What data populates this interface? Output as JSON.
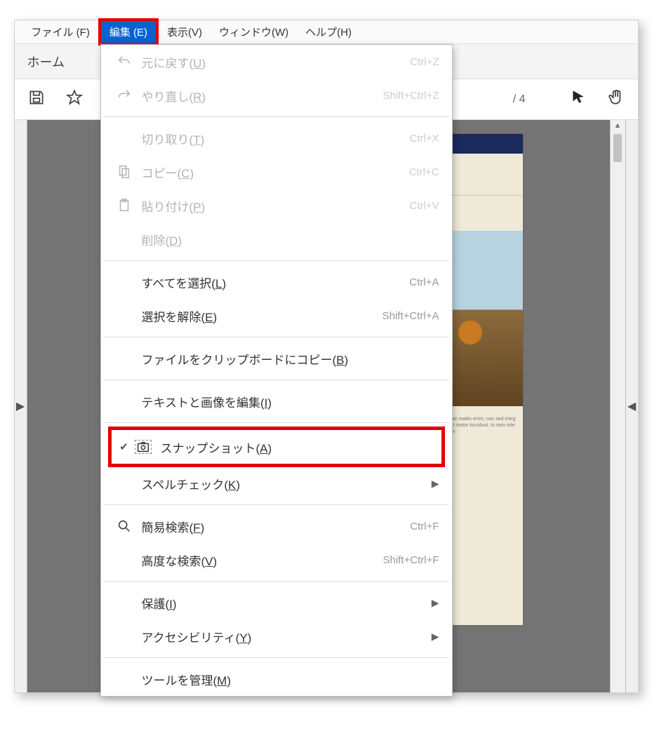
{
  "menubar": {
    "file": "ファイル (F)",
    "edit": "編集 (E)",
    "view": "表示(V)",
    "window": "ウィンドウ(W)",
    "help": "ヘルプ(H)"
  },
  "tabs": {
    "home": "ホーム"
  },
  "toolbar": {
    "page_sep": "/ 4"
  },
  "menu": {
    "undo": "元に戻す",
    "undo_mn": "U",
    "undo_sc": "Ctrl+Z",
    "redo": "やり直し",
    "redo_mn": "R",
    "redo_sc": "Shift+Ctrl+Z",
    "cut": "切り取り",
    "cut_mn": "T",
    "cut_sc": "Ctrl+X",
    "copy": "コピー",
    "copy_mn": "C",
    "copy_sc": "Ctrl+C",
    "paste": "貼り付け",
    "paste_mn": "P",
    "paste_sc": "Ctrl+V",
    "delete": "削除",
    "delete_mn": "D",
    "select_all": "すべてを選択",
    "select_all_mn": "L",
    "select_all_sc": "Ctrl+A",
    "deselect": "選択を解除",
    "deselect_mn": "E",
    "deselect_sc": "Shift+Ctrl+A",
    "copy_file_clip": "ファイルをクリップボードにコピー",
    "copy_file_clip_mn": "B",
    "edit_text_img": "テキストと画像を編集",
    "edit_text_img_mn": "I",
    "snapshot": "スナップショット",
    "snapshot_mn": "A",
    "spellcheck": "スペルチェック",
    "spellcheck_mn": "K",
    "find": "簡易検索",
    "find_mn": "F",
    "find_sc": "Ctrl+F",
    "adv_find": "高度な検索",
    "adv_find_mn": "V",
    "adv_find_sc": "Shift+Ctrl+F",
    "protection": "保護",
    "protection_mn": "I",
    "accessibility": "アクセシビリティ",
    "accessibility_mn": "Y",
    "manage_tools": "ツールを管理",
    "manage_tools_mn": "M"
  },
  "doc_text": "amet placerat ante dolor nec cursus elit in vitae mattis enim, nec sed integer velit integer diam. Ac mattis karpis, sit amet motor tincidunt. In sem integer imperdiet feugiat. Nullam, sed integer sem"
}
